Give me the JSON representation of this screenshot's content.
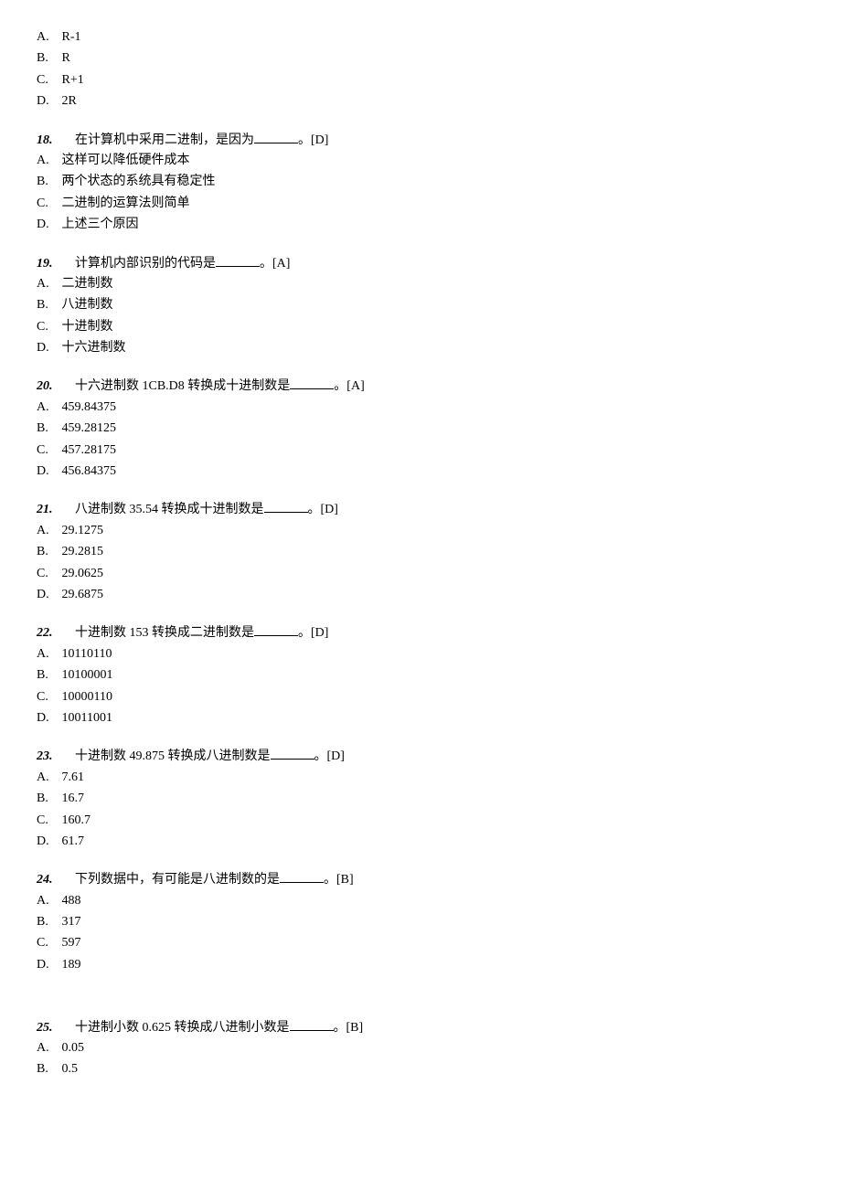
{
  "q17": {
    "choices": {
      "A": "R-1",
      "B": "R",
      "C": "R+1",
      "D": "2R"
    }
  },
  "q18": {
    "num": "18.",
    "text_before": "在计算机中采用二进制，是因为",
    "text_after": "。[D]",
    "choices": {
      "A": "这样可以降低硬件成本",
      "B": "两个状态的系统具有稳定性",
      "C": "二进制的运算法则简单",
      "D": "上述三个原因"
    }
  },
  "q19": {
    "num": "19.",
    "text_before": "计算机内部识别的代码是",
    "text_after": "。[A]",
    "choices": {
      "A": "二进制数",
      "B": "八进制数",
      "C": "十进制数",
      "D": "十六进制数"
    }
  },
  "q20": {
    "num": "20.",
    "text_before": "十六进制数 1CB.D8 转换成十进制数是",
    "text_after": "。[A]",
    "choices": {
      "A": "459.84375",
      "B": "459.28125",
      "C": "457.28175",
      "D": "456.84375"
    }
  },
  "q21": {
    "num": "21.",
    "text_before": "八进制数 35.54 转换成十进制数是",
    "text_after": "。[D]",
    "choices": {
      "A": "29.1275",
      "B": "29.2815",
      "C": "29.0625",
      "D": "29.6875"
    }
  },
  "q22": {
    "num": "22.",
    "text_before": "十进制数 153 转换成二进制数是",
    "text_after": "。[D]",
    "choices": {
      "A": "10110110",
      "B": "10100001",
      "C": "10000110",
      "D": "10011001"
    }
  },
  "q23": {
    "num": "23.",
    "text_before": "十进制数 49.875 转换成八进制数是",
    "text_after": "。[D]",
    "choices": {
      "A": "7.61",
      "B": "16.7",
      "C": "160.7",
      "D": "61.7"
    }
  },
  "q24": {
    "num": "24.",
    "text_before": "下列数据中，有可能是八进制数的是",
    "text_after": "。[B]",
    "choices": {
      "A": "488",
      "B": "317",
      "C": "597",
      "D": "189"
    }
  },
  "q25": {
    "num": "25.",
    "text_before": "十进制小数 0.625 转换成八进制小数是",
    "text_after": "。[B]",
    "choices": {
      "A": "0.05",
      "B": "0.5"
    }
  },
  "letters": {
    "A": "A.",
    "B": "B.",
    "C": "C.",
    "D": "D."
  }
}
